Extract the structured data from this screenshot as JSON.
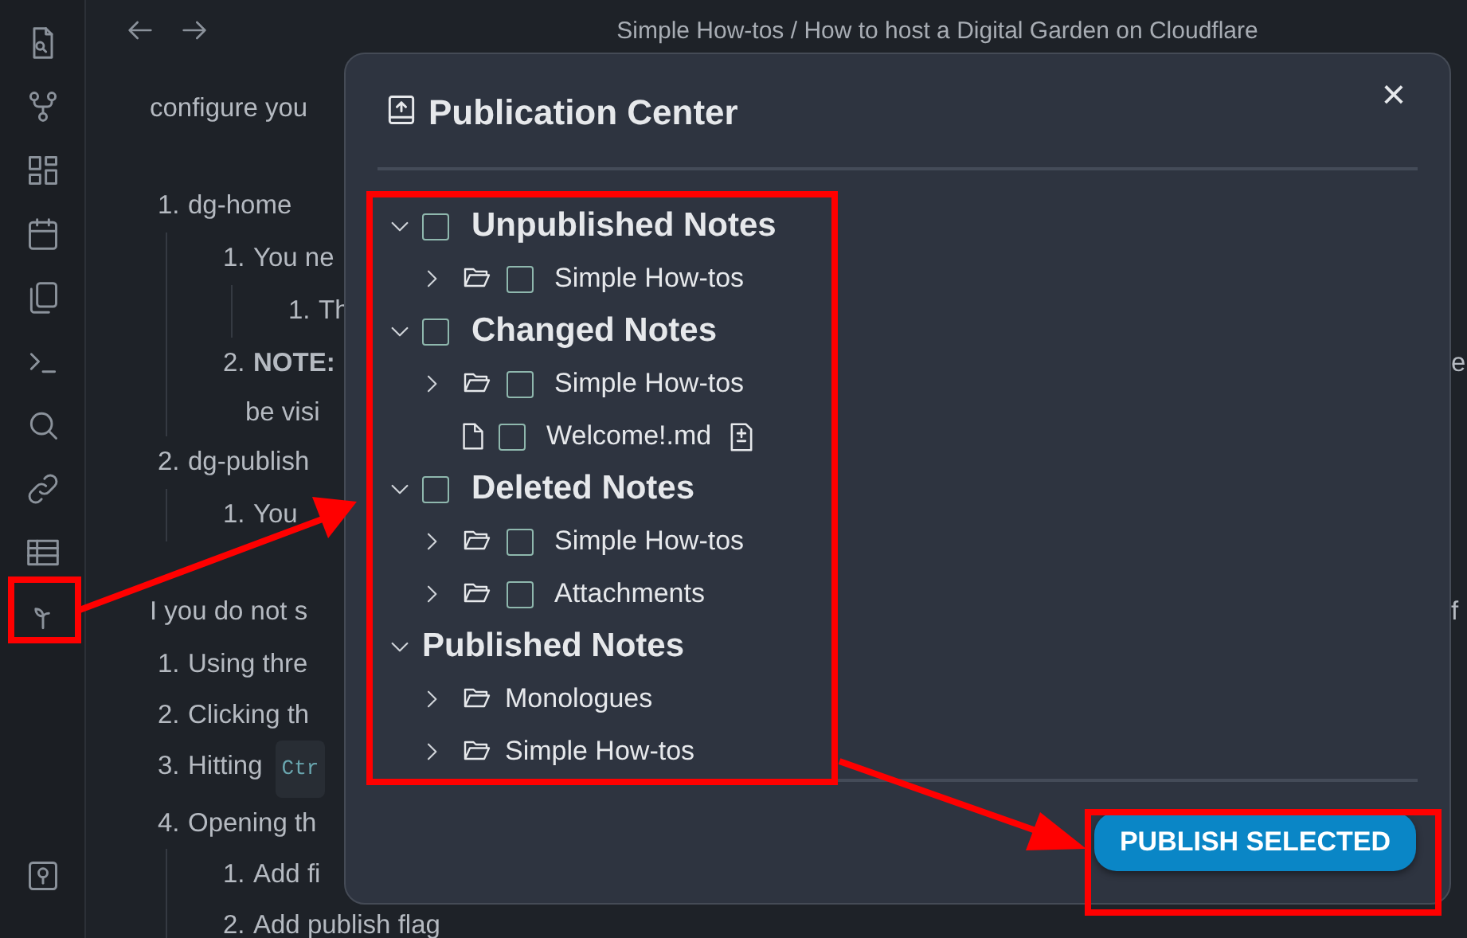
{
  "editor": {
    "breadcrumb": "Simple How-tos / How to host a Digital Garden on Cloudflare",
    "blocks": [
      {
        "kind": "paragraph",
        "text": "configure you"
      },
      {
        "kind": "list",
        "items": [
          {
            "marker": "1.",
            "lines": [
              "dg-home"
            ],
            "children": [
              {
                "marker": "1.",
                "lines": [
                  "You ne"
                ],
                "children": [
                  {
                    "marker": "1.",
                    "lines": [
                      "Th"
                    ]
                  }
                ]
              },
              {
                "marker": "2.",
                "lines": [
                  "**NOTE:**",
                  "be visi"
                ],
                "tail": "e"
              }
            ]
          },
          {
            "marker": "2.",
            "lines": [
              "dg-publish"
            ],
            "children": [
              {
                "marker": "1.",
                "lines": [
                  "You"
                ]
              }
            ]
          }
        ]
      },
      {
        "kind": "paragraph",
        "text": "I you do not s",
        "tail": "f"
      },
      {
        "kind": "list",
        "items": [
          {
            "marker": "1.",
            "lines": [
              "Using thre"
            ]
          },
          {
            "marker": "2.",
            "lines": [
              "Clicking th"
            ]
          },
          {
            "marker": "3.",
            "lines": [
              "Hitting"
            ],
            "code": "Ctr"
          },
          {
            "marker": "4.",
            "lines": [
              "Opening th"
            ],
            "children": [
              {
                "marker": "1.",
                "lines": [
                  "Add fi"
                ]
              },
              {
                "marker": "2.",
                "lines": [
                  "Add publish flag"
                ]
              }
            ]
          }
        ]
      }
    ]
  },
  "modal": {
    "title": "Publication Center",
    "close": "×",
    "sections": [
      {
        "title": "Unpublished Notes",
        "expanded": true,
        "checked": false,
        "items": [
          {
            "kind": "folder",
            "label": "Simple How-tos",
            "expanded": false,
            "checked": false
          }
        ]
      },
      {
        "title": "Changed Notes",
        "expanded": true,
        "checked": false,
        "items": [
          {
            "kind": "folder",
            "label": "Simple How-tos",
            "expanded": false,
            "checked": false
          },
          {
            "kind": "file",
            "label": "Welcome!.md",
            "checked": false
          }
        ]
      },
      {
        "title": "Deleted Notes",
        "expanded": true,
        "checked": false,
        "items": [
          {
            "kind": "folder",
            "label": "Simple How-tos",
            "expanded": false,
            "checked": false
          },
          {
            "kind": "folder",
            "label": "Attachments",
            "expanded": false,
            "checked": false
          }
        ]
      },
      {
        "title": "Published Notes",
        "expanded": true,
        "items": [
          {
            "kind": "folder",
            "label": "Monologues",
            "expanded": false
          },
          {
            "kind": "folder",
            "label": "Simple How-tos",
            "expanded": false
          }
        ]
      }
    ],
    "button": "PUBLISH SELECTED"
  }
}
